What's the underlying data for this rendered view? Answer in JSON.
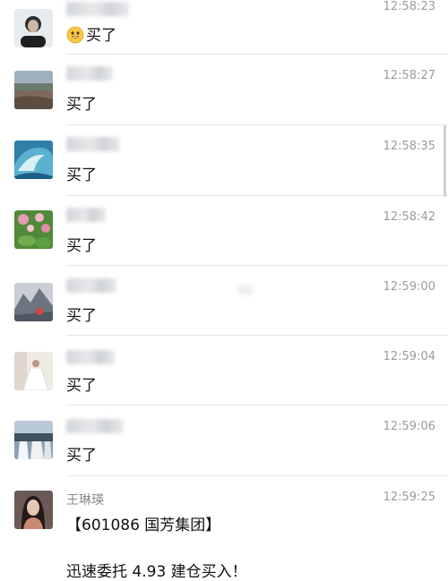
{
  "messages": [
    {
      "name": "",
      "time": "12:58:23",
      "text": "买了",
      "has_emoji": true,
      "emoji_icon": "grinning-face-emoji-icon"
    },
    {
      "name": "",
      "time": "12:58:27",
      "text": "买了"
    },
    {
      "name": "",
      "time": "12:58:35",
      "text": "买了"
    },
    {
      "name": "",
      "time": "12:58:42",
      "text": "买了"
    },
    {
      "name": "",
      "time": "12:59:00",
      "text": "买了"
    },
    {
      "name": "",
      "time": "12:59:04",
      "text": "买了"
    },
    {
      "name": "",
      "time": "12:59:06",
      "text": "买了"
    },
    {
      "name": "王琳瑛",
      "time": "12:59:25",
      "text": "【601086 国芳集团】",
      "text2": "迅速委托 4.93 建仓买入！"
    }
  ],
  "avatars": [
    "person-portrait-avatar",
    "beach-landscape-avatar",
    "ocean-wave-avatar",
    "pink-flowers-avatar",
    "mountain-scenery-avatar",
    "bride-photo-avatar",
    "waterfall-avatar",
    "woman-portrait-avatar"
  ]
}
